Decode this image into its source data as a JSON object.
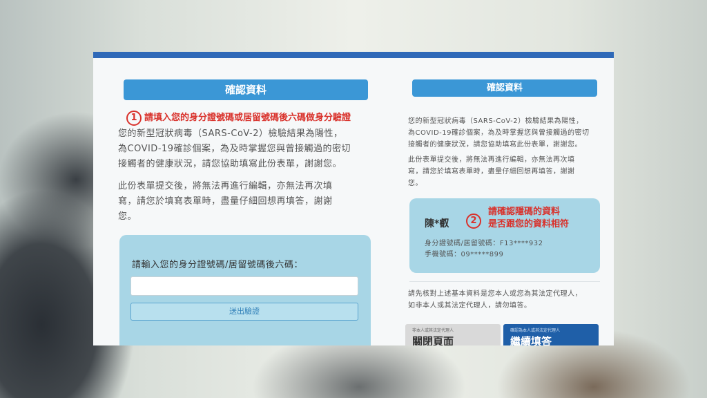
{
  "left": {
    "header": "確認資料",
    "callout": {
      "number": "1",
      "text": "請填入您的身分證號碼或居留號碼後六碼做身分驗證"
    },
    "para1": [
      "您的新型冠狀病毒（SARS-CoV-2）檢驗結果為陽性，",
      "為COVID-19確診個案，為及時掌握您與曾接觸過的密切",
      "接觸者的健康狀況，請您協助填寫此份表單，謝謝您。"
    ],
    "para2": [
      "此份表單提交後，將無法再進行編輯，亦無法再次填",
      "寫，請您於填寫表單時，盡量仔細回想再填答，謝謝",
      "您。"
    ],
    "input_label": "請輸入您的身分證號碼/居留號碼後六碼：",
    "input_value": "",
    "submit_label": "送出驗證"
  },
  "right": {
    "header": "確認資料",
    "para1": [
      "您的新型冠狀病毒（SARS-CoV-2）檢驗結果為陽性，",
      "為COVID-19確診個案，為及時掌握您與曾接觸過的密切",
      "接觸者的健康狀況，請您協助填寫此份表單，謝謝您。"
    ],
    "para2": [
      "此份表單提交後，將無法再進行編輯，亦無法再次填",
      "寫，請您於填寫表單時，盡量仔細回想再填答，謝謝",
      "您。"
    ],
    "info": {
      "name": "陳*叡",
      "id_line": "身分證號碼/居留號碼：F13****932",
      "phone_line": "手機號碼：09*****899"
    },
    "callout": {
      "number": "2",
      "line1": "請確認隱碼的資料",
      "line2": "是否跟您的資料相符"
    },
    "confirm_text": [
      "請先核對上述基本資料是您本人或您為其法定代理人，",
      "如非本人或其法定代理人，請勿填答。"
    ],
    "close_button": {
      "small": "非本人或其法定代理人",
      "label": "關閉頁面"
    },
    "continue_button": {
      "small": "確認為本人或其法定代理人",
      "label": "繼續填答"
    }
  },
  "colors": {
    "accent": "#3b97d6",
    "topbar": "#2f69b8",
    "callout": "#d9312b",
    "box": "#a8d6e6",
    "continue": "#1f5fa8"
  }
}
